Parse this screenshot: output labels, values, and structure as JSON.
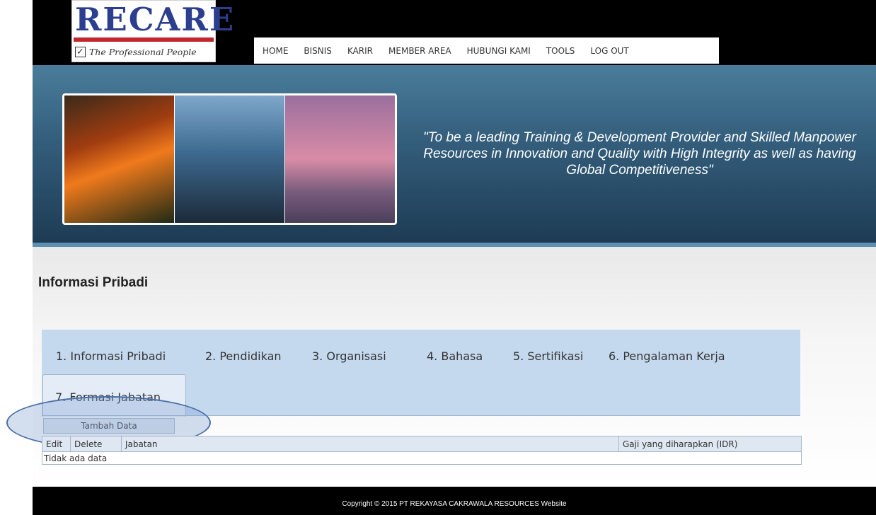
{
  "logo": {
    "word": "RECARE",
    "tagline": "The Professional People",
    "check": "✓"
  },
  "nav": [
    "HOME",
    "BISNIS",
    "KARIR",
    "MEMBER AREA",
    "HUBUNGI KAMI",
    "TOOLS",
    "LOG OUT"
  ],
  "hero": {
    "quote": "\"To be a leading Training & Development Provider and Skilled Manpower Resources in Innovation and Quality with High Integrity as well as having Global Competitiveness\""
  },
  "page": {
    "title": "Informasi Pribadi"
  },
  "tabs": [
    "1. Informasi Pribadi",
    "2. Pendidikan",
    "3. Organisasi",
    "4. Bahasa",
    "5. Sertifikasi",
    "6. Pengalaman Kerja",
    "7. Formasi Jabatan"
  ],
  "toolbar": {
    "add_label": "Tambah Data"
  },
  "table": {
    "headers": [
      "Edit",
      "Delete",
      "Jabatan",
      "Gaji yang diharapkan (IDR)"
    ],
    "empty": "Tidak ada data"
  },
  "footer": {
    "text": "Copyright © 2015 PT REKAYASA CAKRAWALA RESOURCES Website"
  },
  "colors": {
    "brand": "#2c3f8f",
    "accent": "#c1272d",
    "tab_panel": "#c5d9ee",
    "hero": "#345f7d"
  }
}
